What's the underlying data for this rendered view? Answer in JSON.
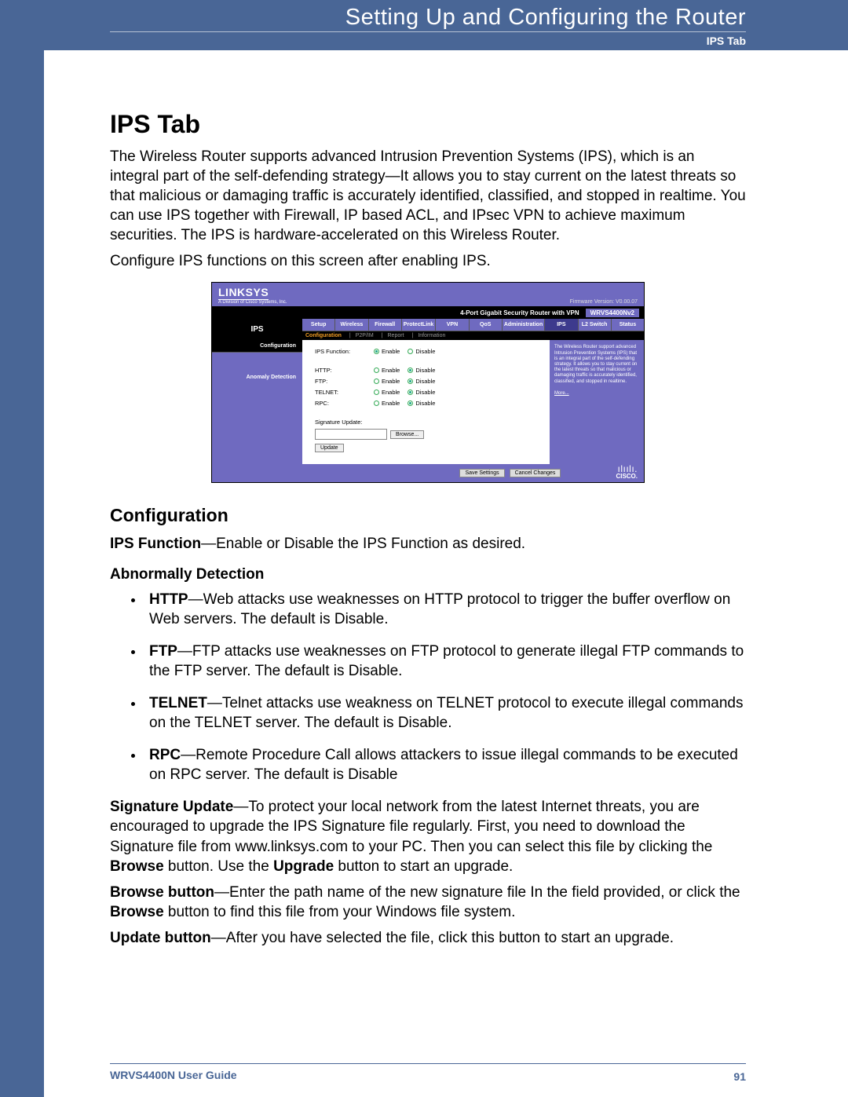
{
  "header": {
    "title": "Setting Up and Configuring the Router",
    "sub": "IPS Tab"
  },
  "section": {
    "h1": "IPS Tab",
    "p1": "The Wireless Router supports advanced Intrusion Prevention Systems (IPS), which is an integral part of the self-defending strategy—It allows you to stay current on the latest threats so that malicious or damaging traffic is accurately identified, classified, and stopped in realtime. You can use IPS together with Firewall, IP based ACL, and IPsec VPN to achieve maximum securities. The IPS is hardware-accelerated on this Wireless Router.",
    "p2": "Configure IPS functions on this screen after enabling IPS.",
    "h2": "Configuration",
    "ips_func_bold": "IPS Function",
    "ips_func_rest": "—Enable or Disable the IPS Function as desired.",
    "h3": "Abnormally Detection",
    "bullets": {
      "http_bold": "HTTP",
      "http_rest": "—Web attacks use weaknesses on HTTP protocol to trigger the buffer overflow on Web servers. The default is Disable.",
      "ftp_bold": "FTP",
      "ftp_rest": "—FTP attacks use weaknesses on FTP protocol to generate illegal FTP commands to the FTP server. The default is Disable.",
      "telnet_bold": "TELNET",
      "telnet_rest": "—Telnet attacks use weakness on TELNET protocol to execute illegal commands on the TELNET server. The default is Disable.",
      "rpc_bold": "RPC",
      "rpc_rest": "—Remote Procedure Call allows attackers to issue illegal commands to be executed on RPC server. The default is Disable"
    },
    "sig_bold": "Signature Update",
    "sig_rest1": "—To protect your local network from the latest Internet threats, you are encouraged to upgrade the IPS Signature file regularly. First, you need to download the Signature file from www.linksys.com to your PC. Then you can select this file by clicking the ",
    "sig_browse": "Browse",
    "sig_rest2": " button. Use the ",
    "sig_upgrade": "Upgrade",
    "sig_rest3": " button to start an upgrade.",
    "browse_bold": "Browse button",
    "browse_rest1": "—Enter the path name of the new signature file In the field provided, or click the ",
    "browse_inline": "Browse",
    "browse_rest2": " button to find this file from your Windows file system.",
    "update_bold": "Update button",
    "update_rest": "—After you have selected the file, click this button to start an upgrade."
  },
  "router": {
    "logo": "LINKSYS",
    "logo_sub": "A Division of Cisco Systems, Inc.",
    "fw": "Firmware Version: V0.00.07",
    "device": "4-Port Gigabit Security Router with VPN",
    "model": "WRVS4400Nv2",
    "big_label": "IPS",
    "tabs": [
      "Setup",
      "Wireless",
      "Firewall",
      "ProtectLink",
      "VPN",
      "QoS",
      "Administration",
      "IPS",
      "L2 Switch",
      "Status"
    ],
    "subtabs": [
      "Configuration",
      "P2P/IM",
      "Report",
      "Information"
    ],
    "side": [
      "Configuration",
      "Anomaly Detection"
    ],
    "form": {
      "ips_label": "IPS Function:",
      "http_label": "HTTP:",
      "ftp_label": "FTP:",
      "telnet_label": "TELNET:",
      "rpc_label": "RPC:",
      "enable": "Enable",
      "disable": "Disable",
      "sig_label": "Signature Update:",
      "browse": "Browse...",
      "update": "Update"
    },
    "help": "The Wireless Router support advanced Intrusion Prevention Systems (IPS) that is an integral part of the self-defending strategy. It allows you to stay current on the latest threats so that malicious or damaging traffic is accurately identified, classified, and stopped in realtime.",
    "help_more": "More...",
    "save": "Save Settings",
    "cancel": "Cancel Changes",
    "cisco": "CISCO."
  },
  "footer": {
    "left": "WRVS4400N User Guide",
    "right": "91"
  }
}
